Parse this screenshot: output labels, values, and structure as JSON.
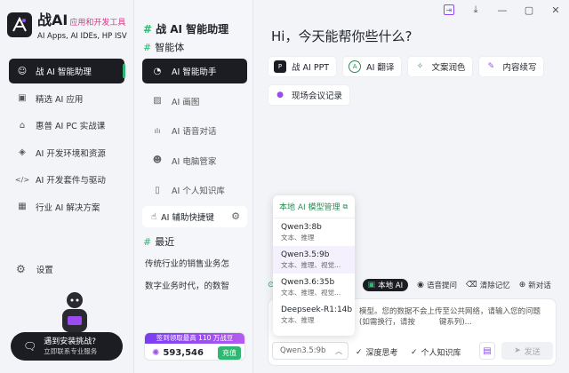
{
  "app": {
    "logo_glyph": "A",
    "title": "战AI",
    "title_sub": "应用和开发工具",
    "subtitle_lines": [
      "AI Apps, AI IDEs, HP ISV"
    ]
  },
  "sidebar": {
    "items": [
      {
        "icon": "robot-icon",
        "glyph": "☺",
        "label": "战 AI 智能助理",
        "active": true
      },
      {
        "icon": "terminal-icon",
        "glyph": "▣",
        "label": "精选 AI 应用",
        "active": false
      },
      {
        "icon": "graduation-icon",
        "glyph": "⌂",
        "label": "惠普 AI PC 实战课",
        "active": false
      },
      {
        "icon": "layers-icon",
        "glyph": "◈",
        "label": "AI 开发环境和资源",
        "active": false
      },
      {
        "icon": "code-icon",
        "glyph": "</>",
        "label": "AI 开发套件与驱动",
        "active": false
      },
      {
        "icon": "grid-icon",
        "glyph": "▦",
        "label": "行业 AI 解决方案",
        "active": false
      }
    ],
    "settings_label": "设置",
    "promo_line1": "遇到安装挑战?",
    "promo_line2": "立即联系专业服务"
  },
  "middle": {
    "title": "战 AI 智能助理",
    "section_agents": "智能体",
    "agents": [
      {
        "icon": "assistant-icon",
        "glyph": "◔",
        "label": "AI 智能助手",
        "active": true
      },
      {
        "icon": "image-icon",
        "glyph": "▨",
        "label": "AI 画图",
        "active": false
      },
      {
        "icon": "voice-icon",
        "glyph": "ılı",
        "label": "AI 语音对话",
        "active": false
      },
      {
        "icon": "user-icon",
        "glyph": "☻",
        "label": "AI 电脑管家",
        "active": false
      },
      {
        "icon": "book-icon",
        "glyph": "▯",
        "label": "AI 个人知识库",
        "active": false
      }
    ],
    "shortcut_label": "AI 辅助快捷键",
    "section_recent": "最近",
    "recent": [
      "传统行业的销售业务怎",
      "数字业务时代，的数智"
    ],
    "points_banner": "签到领取最高 110 万战豆",
    "points_value": "593,546",
    "points_button": "充值"
  },
  "main": {
    "greeting": "Hi，今天能帮你些什么?",
    "chips": [
      {
        "icon": "ppt-icon",
        "glyph": "P",
        "label": "战 AI PPT",
        "color": "#1c1d22"
      },
      {
        "icon": "translate-icon",
        "glyph": "A",
        "label": "AI 翻译",
        "color": "#2e8b57"
      },
      {
        "icon": "sparkle-icon",
        "glyph": "✧",
        "label": "文案润色",
        "color": "#2e8b57"
      },
      {
        "icon": "pen-icon",
        "glyph": "✎",
        "label": "内容续写",
        "color": "#9b4cf0"
      },
      {
        "icon": "mic-icon",
        "glyph": "●",
        "label": "现场会议记录",
        "color": "#9b4cf0"
      }
    ],
    "toolbar": {
      "local_ai": "本地 AI",
      "voice_input": "语音提问",
      "clear_memory": "清除记忆",
      "new_chat": "新对话"
    },
    "input_placeholder": "模型。您的数据不会上传至公共网络，请输入您的问题\n(如需换行，请按          键系列)...",
    "model_selected": "Qwen3.5:9b",
    "deep_think": "深度思考",
    "knowledge_base": "个人知识库",
    "send_label": "发送"
  },
  "dropdown": {
    "header": "本地 AI 模型管理",
    "items": [
      {
        "name": "Qwen3:8b",
        "tags": "文本、推理",
        "selected": false
      },
      {
        "name": "Qwen3.5:9b",
        "tags": "文本、推理、视觉...",
        "selected": true
      },
      {
        "name": "Qwen3.6:35b",
        "tags": "文本、推理、视觉...",
        "selected": false
      },
      {
        "name": "Deepseek-R1:14b",
        "tags": "文本、推理",
        "selected": false
      }
    ]
  }
}
